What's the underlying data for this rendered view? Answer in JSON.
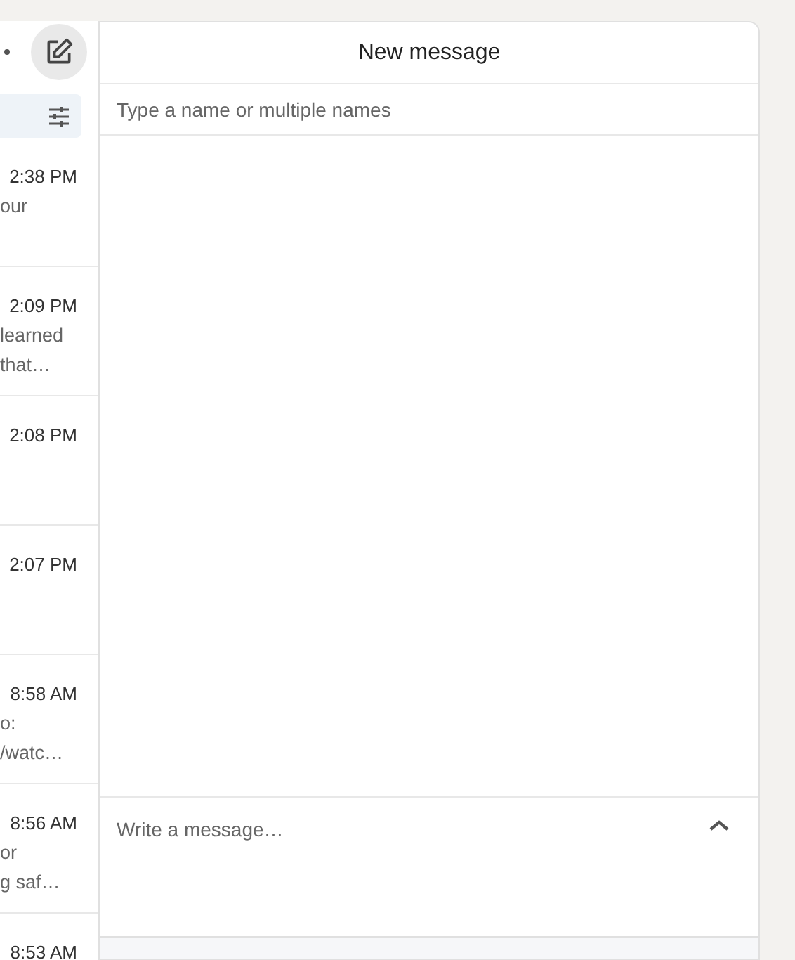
{
  "conversations": [
    {
      "time": "2:38 PM",
      "preview_lines": [
        "our"
      ]
    },
    {
      "time": "2:09 PM",
      "preview_lines": [
        "learned",
        "that…"
      ]
    },
    {
      "time": "2:08 PM"
    },
    {
      "time": "2:07 PM"
    },
    {
      "time": "8:58 AM",
      "preview_lines": [
        "o:",
        "/watc…"
      ]
    },
    {
      "time": "8:56 AM",
      "preview_lines": [
        "or",
        "g saf…"
      ]
    },
    {
      "time": "8:53 AM"
    }
  ],
  "new_message": {
    "title": "New message",
    "recipient": {
      "placeholder": "Type a name or multiple names"
    },
    "message": {
      "placeholder": "Write a message…"
    }
  }
}
